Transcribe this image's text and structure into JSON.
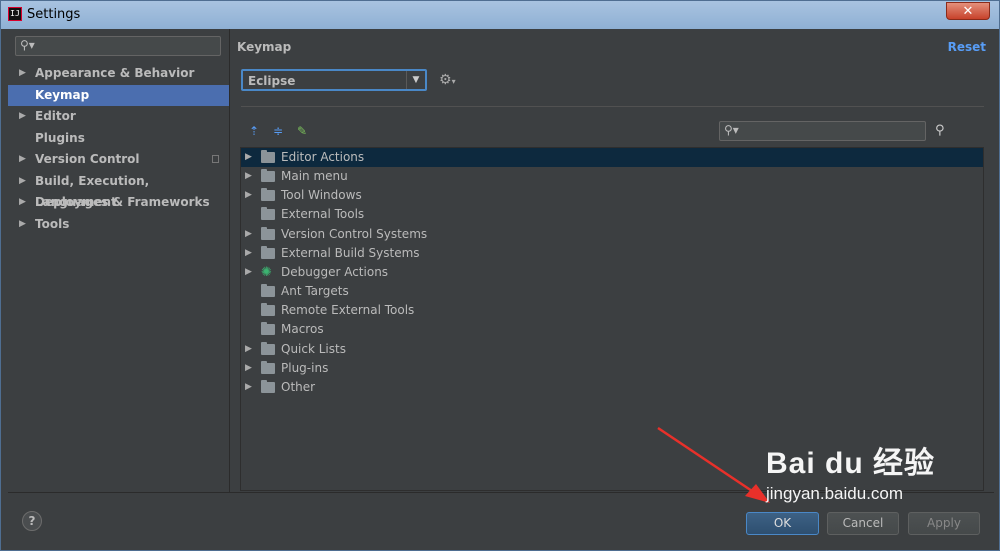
{
  "window": {
    "title": "Settings",
    "close_symbol": "✕"
  },
  "sidebar": {
    "search": {
      "placeholder": ""
    },
    "items": [
      {
        "label": "Appearance & Behavior",
        "expandable": true
      },
      {
        "label": "Keymap",
        "expandable": false,
        "selected": true
      },
      {
        "label": "Editor",
        "expandable": true
      },
      {
        "label": "Plugins",
        "expandable": false
      },
      {
        "label": "Version Control",
        "expandable": true
      },
      {
        "label": "Build, Execution, Deployment",
        "expandable": true
      },
      {
        "label": "Languages & Frameworks",
        "expandable": true
      },
      {
        "label": "Tools",
        "expandable": true
      }
    ]
  },
  "main": {
    "title": "Keymap",
    "reset_label": "Reset",
    "scheme": {
      "value": "Eclipse"
    },
    "tree": [
      {
        "label": "Editor Actions",
        "expandable": true,
        "selected": true,
        "icon": "editor-folder-icon"
      },
      {
        "label": "Main menu",
        "expandable": true,
        "icon": "menu-folder-icon"
      },
      {
        "label": "Tool Windows",
        "expandable": true,
        "icon": "folder-icon"
      },
      {
        "label": "External Tools",
        "expandable": false,
        "icon": "tools-folder-icon"
      },
      {
        "label": "Version Control Systems",
        "expandable": true,
        "icon": "folder-icon"
      },
      {
        "label": "External Build Systems",
        "expandable": true,
        "icon": "build-folder-icon"
      },
      {
        "label": "Debugger Actions",
        "expandable": true,
        "icon": "bug-icon"
      },
      {
        "label": "Ant Targets",
        "expandable": false,
        "icon": "ant-folder-icon"
      },
      {
        "label": "Remote External Tools",
        "expandable": false,
        "icon": "tools-folder-icon"
      },
      {
        "label": "Macros",
        "expandable": false,
        "icon": "folder-icon"
      },
      {
        "label": "Quick Lists",
        "expandable": true,
        "icon": "folder-icon"
      },
      {
        "label": "Plug-ins",
        "expandable": true,
        "icon": "folder-icon"
      },
      {
        "label": "Other",
        "expandable": true,
        "icon": "other-folder-icon"
      }
    ]
  },
  "footer": {
    "help_label": "?",
    "ok_label": "OK",
    "cancel_label": "Cancel",
    "apply_label": "Apply"
  },
  "watermark": {
    "logo": "Bai du 经验",
    "url": "jingyan.baidu.com"
  },
  "colors": {
    "accent": "#4b6eaf",
    "link": "#589df6",
    "background": "#3c3f41",
    "arrow": "#e8302a"
  }
}
